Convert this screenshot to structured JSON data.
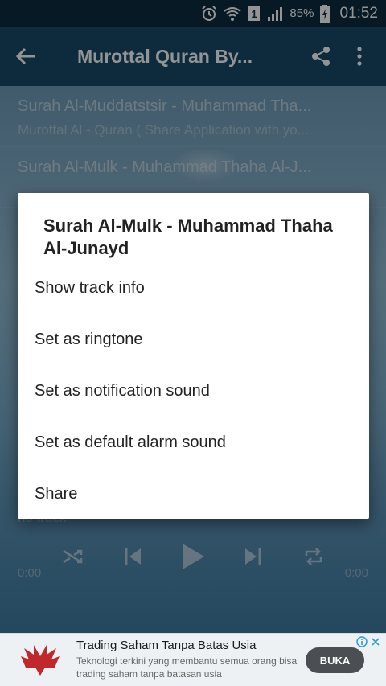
{
  "status_bar": {
    "battery": "85%",
    "time": "01:52",
    "icons": [
      "alarm-icon",
      "wifi-icon",
      "sim-1-icon",
      "signal-icon",
      "battery-charging-icon"
    ]
  },
  "toolbar": {
    "title": "Murottal Quran By...",
    "icons": [
      "back-arrow-icon",
      "share-icon",
      "more-vert-icon"
    ]
  },
  "list": {
    "items": [
      {
        "title": "Surah Al-Muddatstsir - Muhammad Tha...",
        "subtitle": "Murottal Al - Quran ( Share Application with yo..."
      },
      {
        "title": "Surah Al-Mulk - Muhammad Thaha Al-J..."
      }
    ]
  },
  "player": {
    "track": "no track",
    "time_start": "0:00",
    "time_end": "0:00",
    "icons": [
      "shuffle-icon",
      "skip-previous-icon",
      "play-icon",
      "skip-next-icon",
      "repeat-icon"
    ]
  },
  "dialog": {
    "title": "Surah Al-Mulk - Muhammad Thaha Al-Junayd",
    "options": [
      "Show track info",
      "Set as ringtone",
      "Set as notification sound",
      "Set as default alarm sound",
      "Share"
    ]
  },
  "ad": {
    "title": "Trading Saham Tanpa Batas Usia",
    "description": "Teknologi terkini yang membantu semua orang bisa trading saham tanpa batasan usia",
    "button": "BUKA",
    "colors": {
      "logo": "#c0282b",
      "button": "#4b4f53"
    }
  }
}
